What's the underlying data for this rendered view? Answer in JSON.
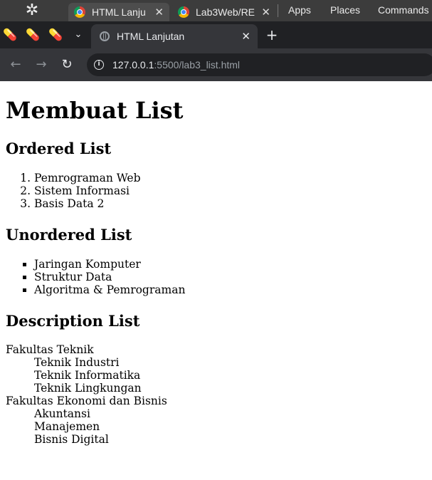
{
  "os_panel": {
    "tasks": [
      {
        "label": "HTML Lanju"
      },
      {
        "label": "Lab3Web/RE"
      }
    ],
    "menus": [
      "Apps",
      "Places",
      "Commands"
    ]
  },
  "browser": {
    "active_tab_title": "HTML Lanjutan",
    "url_host": "127.0.0.1",
    "url_rest": ":5500/lab3_list.html"
  },
  "content": {
    "heading": "Membuat List",
    "ordered": {
      "title": "Ordered List",
      "items": [
        "Pemrograman Web",
        "Sistem Informasi",
        "Basis Data 2"
      ]
    },
    "unordered": {
      "title": "Unordered List",
      "items": [
        "Jaringan Komputer",
        "Struktur Data",
        "Algoritma & Pemrograman"
      ]
    },
    "description": {
      "title": "Description List",
      "groups": [
        {
          "term": "Fakultas Teknik",
          "defs": [
            "Teknik Industri",
            "Teknik Informatika",
            "Teknik Lingkungan"
          ]
        },
        {
          "term": "Fakultas Ekonomi dan Bisnis",
          "defs": [
            "Akuntansi",
            "Manajemen",
            "Bisnis Digital"
          ]
        }
      ]
    }
  }
}
